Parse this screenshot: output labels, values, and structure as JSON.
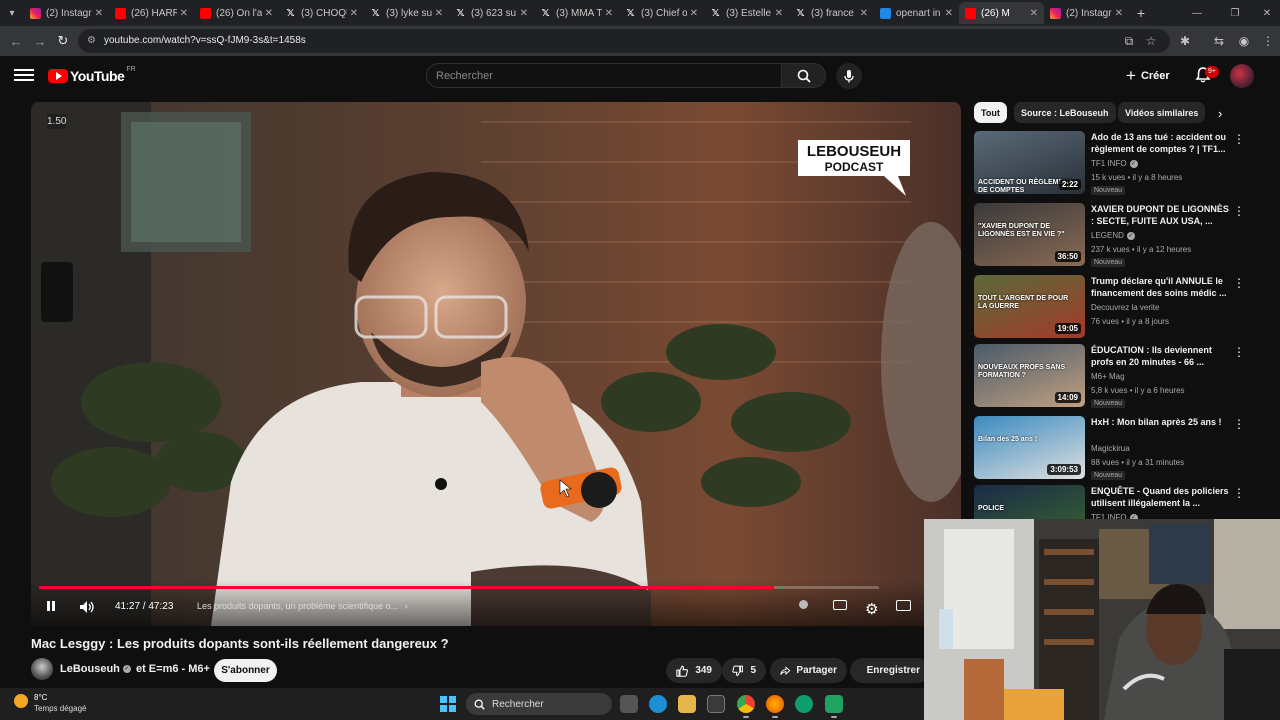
{
  "browser": {
    "tabs": [
      {
        "label": "(2) Instagr",
        "favicon": "instagram"
      },
      {
        "label": "(26) HARR",
        "favicon": "youtube"
      },
      {
        "label": "(26) On l'a",
        "favicon": "youtube"
      },
      {
        "label": "(3) CHOQU",
        "favicon": "x"
      },
      {
        "label": "(3) lyke su",
        "favicon": "x"
      },
      {
        "label": "(3) 623 su",
        "favicon": "x"
      },
      {
        "label": "(3) MMA T",
        "favicon": "x"
      },
      {
        "label": "(3) Chief o",
        "favicon": "x"
      },
      {
        "label": "(3) Estelle",
        "favicon": "x"
      },
      {
        "label": "(3) france",
        "favicon": "x"
      },
      {
        "label": "openart in",
        "favicon": "image"
      },
      {
        "label": "(26) M",
        "favicon": "youtube",
        "active": true
      },
      {
        "label": "(2) Instagr",
        "favicon": "instagram"
      }
    ],
    "url": "youtube.com/watch?v=ssQ-fJM9-3s&t=1458s"
  },
  "header": {
    "logo_text": "YouTube",
    "logo_country": "FR",
    "search_placeholder": "Rechercher",
    "create_label": "Créer",
    "notif_count": "9+"
  },
  "player": {
    "speed_label": "1.50",
    "podcast_logo_line1": "LEBOUSEUH",
    "podcast_logo_line2": "PODCAST",
    "time_current": "41:27",
    "time_total": "47:23",
    "time_text": "41:27 / 47:23",
    "chapter": "Les produits dopants, un problème scientifique o...",
    "progress": 0.8748
  },
  "video": {
    "title": "Mac Lesggy : Les produits dopants sont-ils réellement dangereux ?",
    "channel": "LeBouseuh",
    "collab": "et E=m6 - M6+",
    "subscribe_label": "S'abonner",
    "likes": "349",
    "dislikes": "5",
    "share_label": "Partager",
    "save_label": "Enregistrer"
  },
  "chips": [
    {
      "label": "Tout",
      "active": true
    },
    {
      "label": "Source : LeBouseuh"
    },
    {
      "label": "Vidéos similaires"
    }
  ],
  "recommendations": [
    {
      "title": "Ado de 13 ans tué : accident ou règlement de comptes ? | TF1...",
      "channel": "TF1 INFO",
      "verified": true,
      "meta": "15 k vues • il y a 8 heures",
      "badge": "Nouveau",
      "duration": "2:22",
      "thumb_text": "ACCIDENT OU RÈGLEMENT DE COMPTES"
    },
    {
      "title": "XAVIER DUPONT DE LIGONNÈS : SECTE, FUITE AUX USA, ...",
      "channel": "LEGEND",
      "verified": true,
      "meta": "237 k vues • il y a 12 heures",
      "badge": "Nouveau",
      "duration": "36:50",
      "thumb_text": "\"XAVIER DUPONT DE LIGONNÈS EST EN VIE ?\""
    },
    {
      "title": "Trump déclare qu'il ANNULE le financement des soins médic ...",
      "channel": "Decouvrez la verite",
      "verified": false,
      "meta": "76 vues • il y a 8 jours",
      "badge": "",
      "duration": "19:05",
      "thumb_text": "TOUT L'ARGENT DE POUR LA GUERRE"
    },
    {
      "title": "ÉDUCATION : Ils deviennent profs en 20 minutes - 66 ...",
      "channel": "M6+ Mag",
      "verified": false,
      "meta": "5,8 k vues • il y a 6 heures",
      "badge": "Nouveau",
      "duration": "14:09",
      "thumb_text": "NOUVEAUX PROFS SANS FORMATION ?"
    },
    {
      "title": "HxH : Mon bilan après 25 ans !",
      "channel": "Magickirua",
      "verified": false,
      "meta": "88 vues • il y a 31 minutes",
      "badge": "Nouveau",
      "duration": "3:09:53",
      "thumb_text": "Bilan des 25 ans !"
    },
    {
      "title": "ENQUÊTE - Quand des policiers utilisent illégalement la ...",
      "channel": "TF1 INFO",
      "verified": true,
      "meta": "",
      "badge": "",
      "duration": "",
      "thumb_text": "POLICE"
    }
  ],
  "taskbar": {
    "weather_temp": "8°C",
    "weather_desc": "Temps dégagé",
    "search_label": "Rechercher"
  },
  "colors": {
    "yt_red": "#ff0000",
    "progress_red": "#ff0033",
    "bg": "#0f0f0f",
    "chip": "#272727"
  }
}
